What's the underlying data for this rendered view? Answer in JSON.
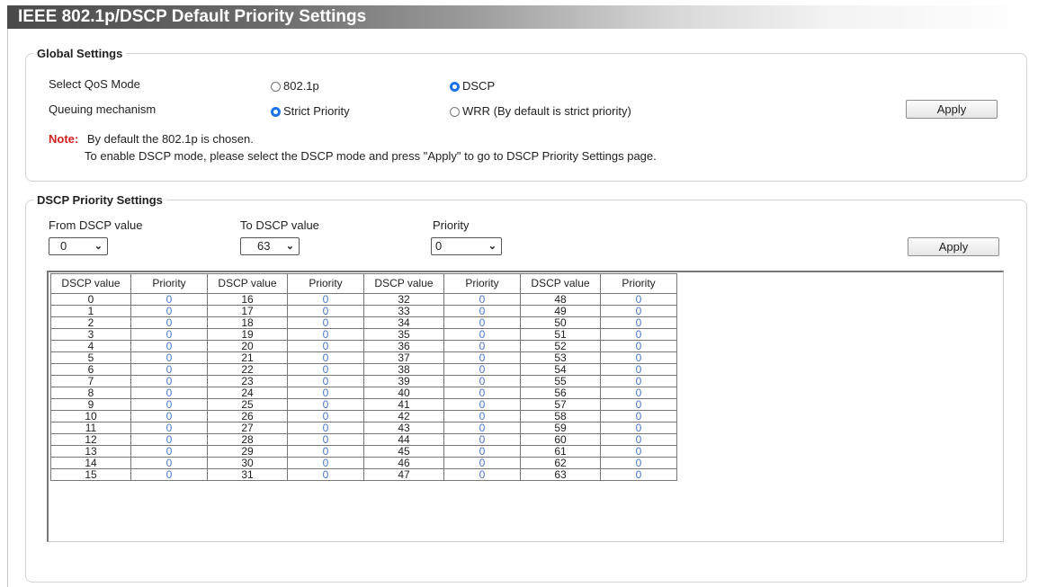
{
  "page": {
    "title": "IEEE 802.1p/DSCP Default Priority Settings"
  },
  "global_settings": {
    "legend": "Global Settings",
    "qos_mode_label": "Select QoS Mode",
    "qos_mode_options": [
      {
        "label": "802.1p",
        "selected": false
      },
      {
        "label": "DSCP",
        "selected": true
      }
    ],
    "queuing_label": "Queuing mechanism",
    "queuing_options": [
      {
        "label": "Strict Priority",
        "selected": true
      },
      {
        "label": "WRR (By default is strict priority)",
        "selected": false
      }
    ],
    "apply_label": "Apply",
    "note_label": "Note:",
    "note_line1": "By default the 802.1p is chosen.",
    "note_line2": "To enable DSCP mode, please select the DSCP mode and press \"Apply\" to go to DSCP Priority Settings page."
  },
  "dscp_settings": {
    "legend": "DSCP Priority Settings",
    "from_label": "From DSCP value",
    "from_value": "0",
    "to_label": "To DSCP value",
    "to_value": "63",
    "priority_label": "Priority",
    "priority_value": "0",
    "apply_label": "Apply"
  },
  "table": {
    "headers": [
      "DSCP value",
      "Priority",
      "DSCP value",
      "Priority",
      "DSCP value",
      "Priority",
      "DSCP value",
      "Priority"
    ],
    "rows": [
      [
        "0",
        "0",
        "16",
        "0",
        "32",
        "0",
        "48",
        "0"
      ],
      [
        "1",
        "0",
        "17",
        "0",
        "33",
        "0",
        "49",
        "0"
      ],
      [
        "2",
        "0",
        "18",
        "0",
        "34",
        "0",
        "50",
        "0"
      ],
      [
        "3",
        "0",
        "19",
        "0",
        "35",
        "0",
        "51",
        "0"
      ],
      [
        "4",
        "0",
        "20",
        "0",
        "36",
        "0",
        "52",
        "0"
      ],
      [
        "5",
        "0",
        "21",
        "0",
        "37",
        "0",
        "53",
        "0"
      ],
      [
        "6",
        "0",
        "22",
        "0",
        "38",
        "0",
        "54",
        "0"
      ],
      [
        "7",
        "0",
        "23",
        "0",
        "39",
        "0",
        "55",
        "0"
      ],
      [
        "8",
        "0",
        "24",
        "0",
        "40",
        "0",
        "56",
        "0"
      ],
      [
        "9",
        "0",
        "25",
        "0",
        "41",
        "0",
        "57",
        "0"
      ],
      [
        "10",
        "0",
        "26",
        "0",
        "42",
        "0",
        "58",
        "0"
      ],
      [
        "11",
        "0",
        "27",
        "0",
        "43",
        "0",
        "59",
        "0"
      ],
      [
        "12",
        "0",
        "28",
        "0",
        "44",
        "0",
        "60",
        "0"
      ],
      [
        "13",
        "0",
        "29",
        "0",
        "45",
        "0",
        "61",
        "0"
      ],
      [
        "14",
        "0",
        "30",
        "0",
        "46",
        "0",
        "62",
        "0"
      ],
      [
        "15",
        "0",
        "31",
        "0",
        "47",
        "0",
        "63",
        "0"
      ]
    ]
  }
}
